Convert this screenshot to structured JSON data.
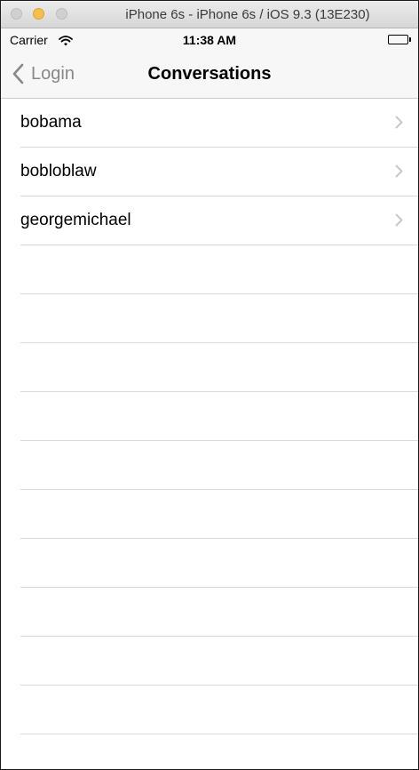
{
  "window": {
    "title": "iPhone 6s - iPhone 6s / iOS 9.3 (13E230)"
  },
  "status_bar": {
    "carrier": "Carrier",
    "time": "11:38 AM",
    "wifi_icon": "wifi-icon",
    "battery_icon": "battery-icon",
    "battery_level": 1.0
  },
  "nav_bar": {
    "back_label": "Login",
    "back_icon": "chevron-left-icon",
    "title": "Conversations"
  },
  "conversations": [
    {
      "name": "bobama"
    },
    {
      "name": "bobloblaw"
    },
    {
      "name": "georgemichael"
    }
  ],
  "empty_rows": 10,
  "colors": {
    "back_tint": "#888888",
    "separator": "#d9d9dd",
    "chevron": "#c7c7cc",
    "bar_background": "#f7f7f7",
    "minimize_light": "#f5bf4f"
  }
}
